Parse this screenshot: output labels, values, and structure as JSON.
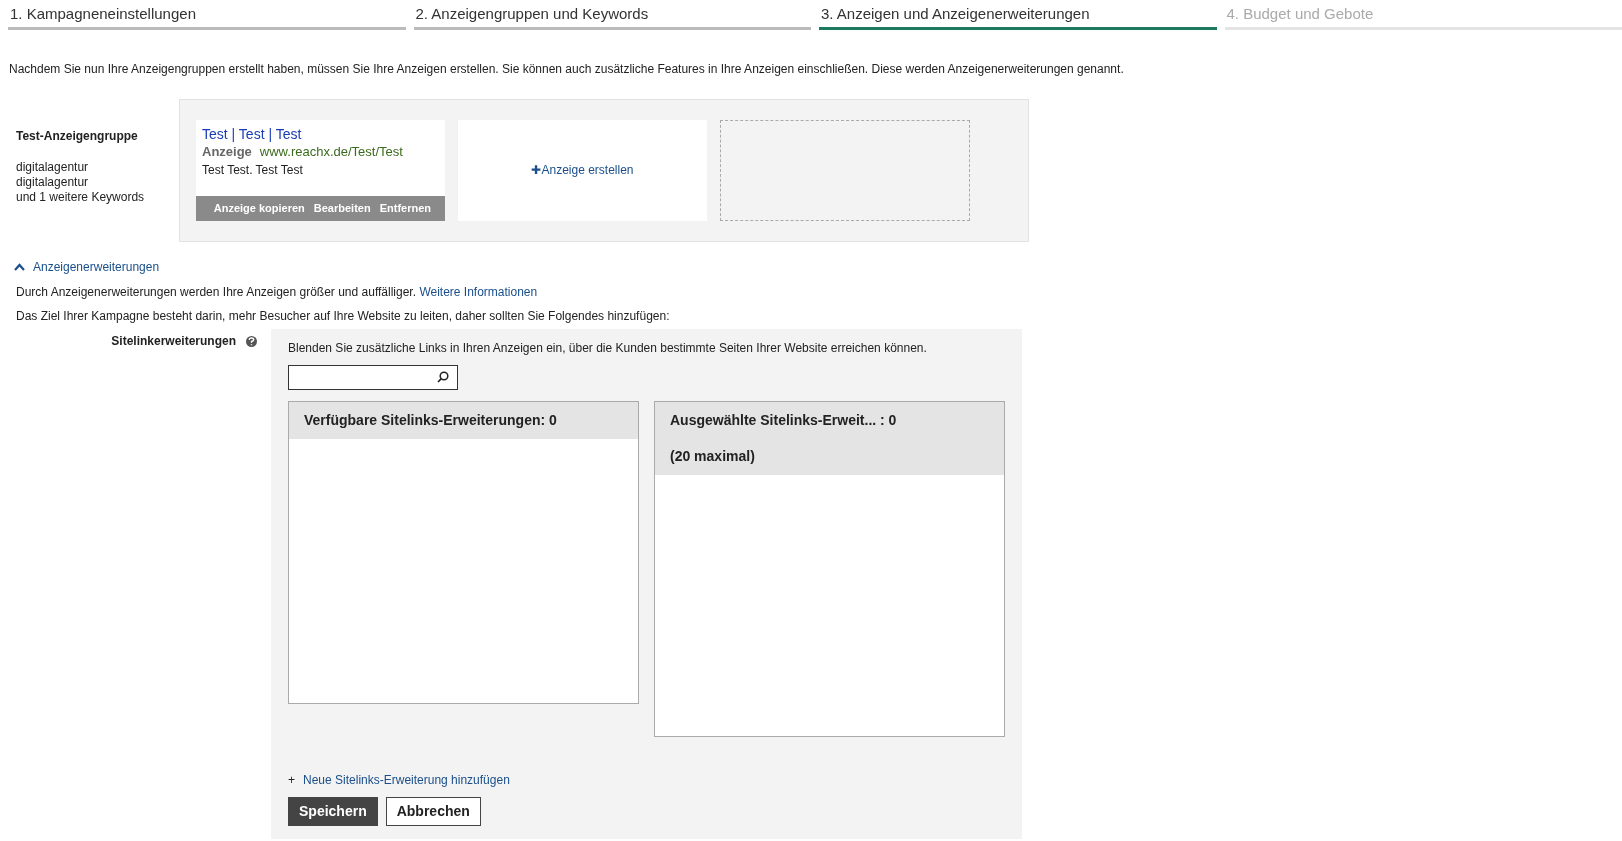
{
  "steps": [
    {
      "label": "1. Kampagneneinstellungen",
      "selected": false,
      "disabled": false
    },
    {
      "label": "2. Anzeigengruppen und Keywords",
      "selected": false,
      "disabled": false
    },
    {
      "label": "3. Anzeigen und Anzeigenerweiterungen",
      "selected": true,
      "disabled": false
    },
    {
      "label": "4. Budget und Gebote",
      "selected": false,
      "disabled": true
    }
  ],
  "intro": "Nachdem Sie nun Ihre Anzeigengruppen erstellt haben, müssen Sie Ihre Anzeigen erstellen. Sie können auch zusätzliche Features in Ihre Anzeigen einschließen. Diese werden Anzeigenerweiterungen genannt.",
  "ad_group": {
    "name": "Test-Anzeigengruppe",
    "keywords": [
      "digitalagentur",
      "digitalagentur",
      "und 1 weitere Keywords"
    ],
    "ad": {
      "headline": "Test | Test | Test",
      "label": "Anzeige",
      "url": "www.reachx.de/Test/Test",
      "description": "Test Test. Test Test",
      "actions": [
        "Anzeige kopieren",
        "Bearbeiten",
        "Entfernen"
      ]
    },
    "create_ad": {
      "icon": "✚",
      "label": "Anzeige erstellen"
    }
  },
  "extensions": {
    "title": "Anzeigenerweiterungen",
    "expanded": true,
    "description": "Durch Anzeigenerweiterungen werden Ihre Anzeigen größer und auffälliger.",
    "more_link": "Weitere Informationen",
    "goal": "Das Ziel Ihrer Kampagne besteht darin, mehr Besucher auf Ihre Website zu leiten, daher sollten Sie Folgendes hinzufügen:",
    "sitelinks": {
      "label": "Sitelinkerweiterungen",
      "hint": "Blenden Sie zusätzliche Links in Ihren Anzeigen ein, über die Kunden bestimmte Seiten Ihrer Website erreichen können.",
      "available": {
        "title": "Verfügbare Sitelinks-Erweiterungen:  0"
      },
      "chosen": {
        "title": "Ausgewählte Sitelinks-Erweit... :  0",
        "subtitle": "(20 maximal)"
      },
      "add_icon": "+",
      "add_link": "Neue Sitelinks-Erweiterung hinzufügen",
      "buttons": [
        {
          "label": "Speichern",
          "kind": "primary"
        },
        {
          "label": "Abbrechen",
          "kind": "secondary"
        }
      ]
    }
  }
}
